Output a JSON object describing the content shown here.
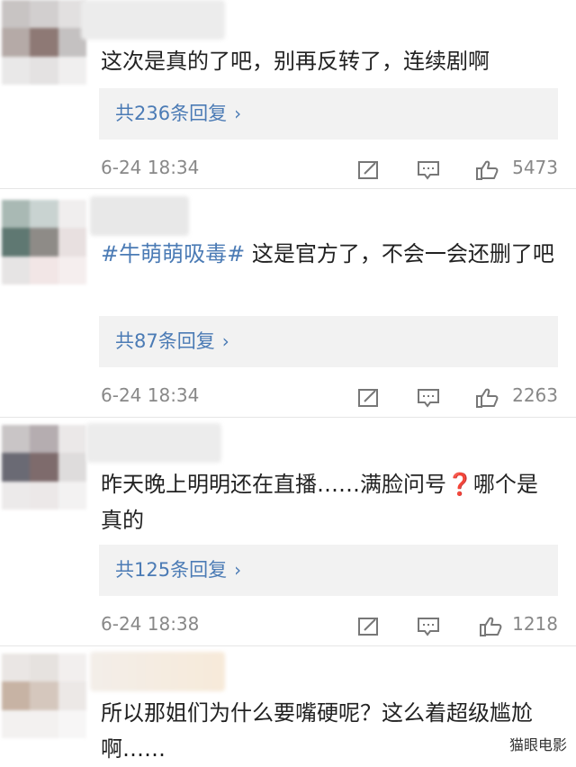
{
  "comments": [
    {
      "text": "这次是真的了吧，别再反转了，连续剧啊",
      "hashtag": "",
      "replies_label": "共236条回复",
      "time": "6-24 18:34",
      "likes": "5473"
    },
    {
      "text": "这是官方了，不会一会还删了吧",
      "hashtag": "#牛萌萌吸毒#",
      "replies_label": "共87条回复",
      "time": "6-24 18:34",
      "likes": "2263"
    },
    {
      "text_before": "昨天晚上明明还在直播……满脸问号",
      "qmark": "❓",
      "text_after": "哪个是真的",
      "replies_label": "共125条回复",
      "time": "6-24 18:38",
      "likes": "1218"
    },
    {
      "text": "所以那姐们为什么要嘴硬呢？这么着超级尴尬啊……"
    }
  ],
  "icons": {
    "repost": "repost-icon",
    "comment": "comment-icon",
    "like": "thumbs-up-icon",
    "chevron": "chevron-right-icon"
  },
  "colors": {
    "link": "#4b7bb5",
    "meta": "#888888",
    "reply_bg": "#f2f2f2"
  },
  "watermark": "猫眼电影"
}
